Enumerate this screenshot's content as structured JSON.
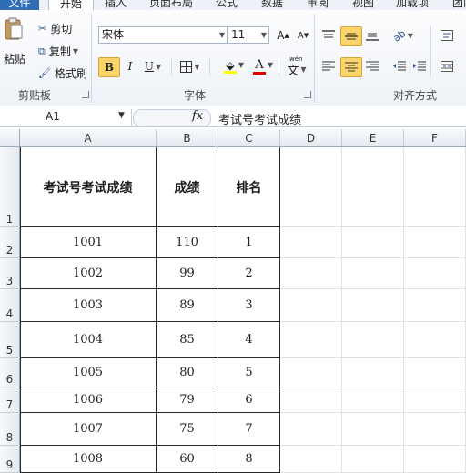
{
  "tabs": [
    {
      "label": "文件"
    },
    {
      "label": "开始"
    },
    {
      "label": "插入"
    },
    {
      "label": "页面布局"
    },
    {
      "label": "公式"
    },
    {
      "label": "数据"
    },
    {
      "label": "审阅"
    },
    {
      "label": "视图"
    },
    {
      "label": "加载项"
    },
    {
      "label": "团队"
    }
  ],
  "clipboard": {
    "paste": "粘贴",
    "cut": "剪切",
    "copy": "复制",
    "format_painter": "格式刷",
    "group_label": "剪贴板"
  },
  "font": {
    "name": "宋体",
    "size": "11",
    "grow": "A",
    "shrink": "A",
    "bold": "B",
    "italic": "I",
    "underline": "U",
    "font_color_letter": "A",
    "wen_glyph": "wén",
    "group_label": "字体"
  },
  "alignment": {
    "group_label": "对齐方式"
  },
  "formula_bar": {
    "name_box": "A1",
    "fx": "fx",
    "value": "考试号考试成绩"
  },
  "columns": [
    "A",
    "B",
    "C",
    "D",
    "E",
    "F"
  ],
  "rows": [
    "1",
    "2",
    "3",
    "4",
    "5",
    "6",
    "7",
    "8",
    "9"
  ],
  "table": {
    "headers": [
      "考试号考试成绩",
      "成绩",
      "排名"
    ],
    "rows": [
      [
        "1001",
        "110",
        "1"
      ],
      [
        "1002",
        "99",
        "2"
      ],
      [
        "1003",
        "89",
        "3"
      ],
      [
        "1004",
        "85",
        "4"
      ],
      [
        "1005",
        "80",
        "5"
      ],
      [
        "1006",
        "79",
        "6"
      ],
      [
        "1007",
        "75",
        "7"
      ],
      [
        "1008",
        "60",
        "8"
      ]
    ]
  },
  "colors": {
    "file_tab": "#2f6db5",
    "toggle_on": "#fbd56a",
    "font_color_bar": "#e00000",
    "fill_color_bar": "#ffff00"
  }
}
